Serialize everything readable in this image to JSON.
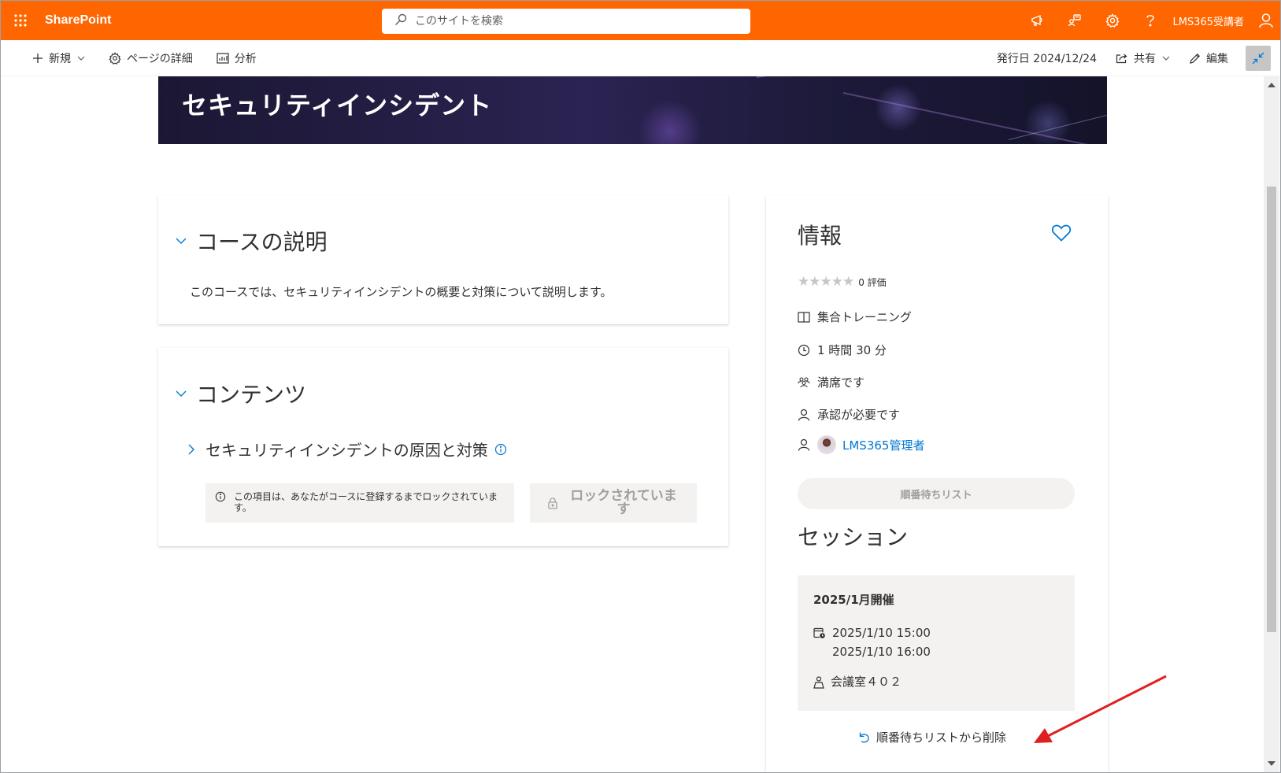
{
  "suitebar": {
    "brand": "SharePoint",
    "search_placeholder": "このサイトを検索",
    "user_name": "LMS365受講者",
    "icons": [
      "waffle-icon",
      "megaphone-icon",
      "share-icon",
      "gear-icon",
      "help-icon",
      "person-icon"
    ]
  },
  "commandbar": {
    "new_label": "新規",
    "page_details_label": "ページの詳細",
    "analytics_label": "分析",
    "published_label": "発行日 2024/12/24",
    "share_label": "共有",
    "edit_label": "編集"
  },
  "hero": {
    "title": "セキュリティインシデント"
  },
  "description": {
    "title": "コースの説明",
    "text": "このコースでは、セキュリティインシデントの概要と対策について説明します。"
  },
  "contents": {
    "title": "コンテンツ",
    "item_title": "セキュリティインシデントの原因と対策",
    "lock_note": "この項目は、あなたがコースに登録するまでロックされています。",
    "lock_button": "ロックされています"
  },
  "info": {
    "title": "情報",
    "rating_text": "0 評価",
    "rating_value": 0,
    "rating_max": 5,
    "training_type": "集合トレーニング",
    "duration": "1 時間 30 分",
    "capacity": "満席です",
    "approval": "承認が必要です",
    "author": "LMS365管理者",
    "waitlist_button": "順番待ちリスト"
  },
  "session": {
    "title": "セッション",
    "name": "2025/1月開催",
    "start": "2025/1/10 15:00",
    "end": "2025/1/10 16:00",
    "location": "会議室４０２",
    "remove_link": "順番待ちリストから削除"
  },
  "colors": {
    "suitebar": "#ff6600",
    "link": "#0078d4",
    "annotation_arrow": "#e02020"
  }
}
